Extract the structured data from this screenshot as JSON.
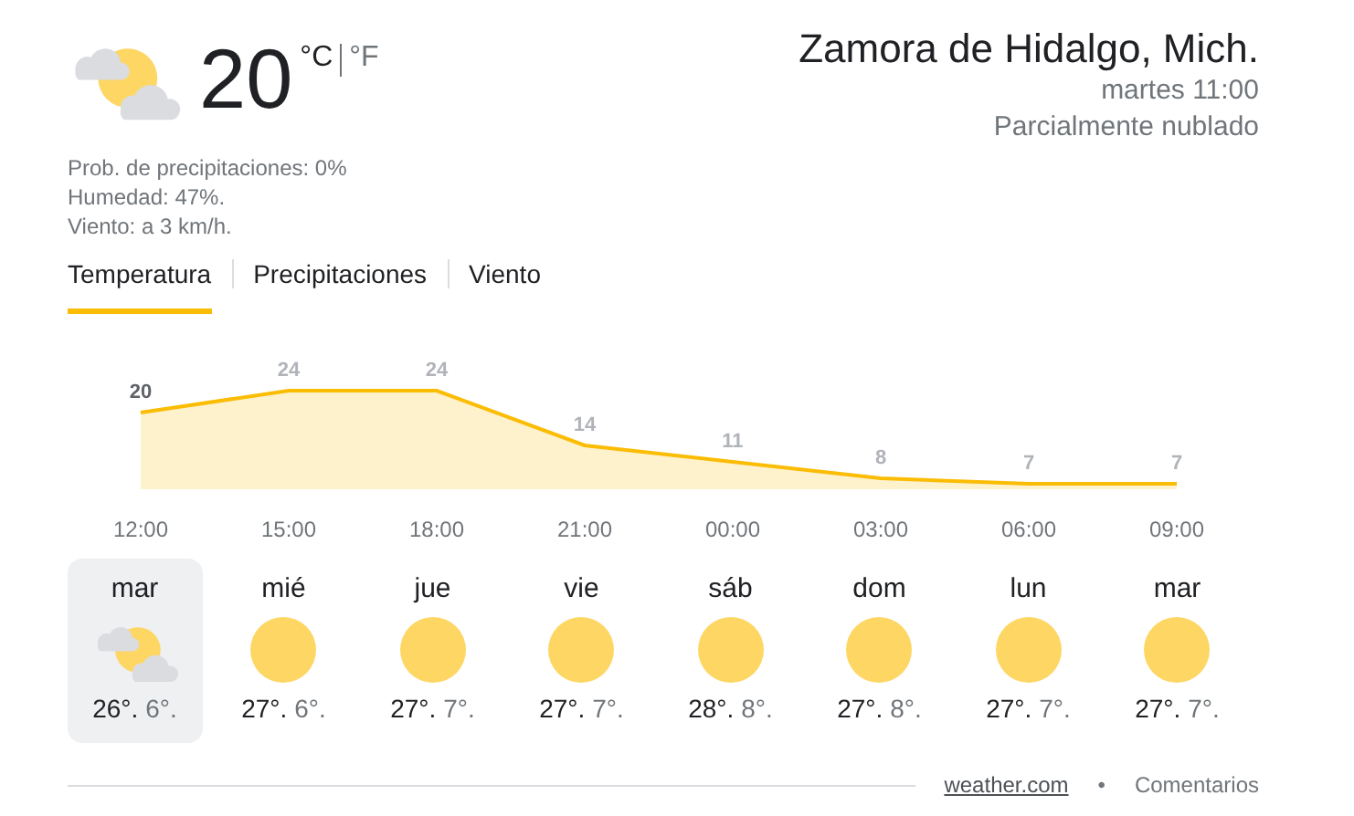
{
  "current": {
    "kind": "partly_cloudy",
    "temperature": "20",
    "units": [
      {
        "label": "°C",
        "selected": true
      },
      {
        "label": "°F",
        "selected": false
      }
    ],
    "details": [
      "Prob. de precipitaciones: 0%",
      "Humedad: 47%.",
      "Viento: a 3 km/h."
    ]
  },
  "location": {
    "name": "Zamora de Hidalgo, Mich.",
    "time": "martes 11:00",
    "condition": "Parcialmente nublado"
  },
  "tabs": [
    {
      "label": "Temperatura",
      "selected": true
    },
    {
      "label": "Precipitaciones",
      "selected": false
    },
    {
      "label": "Viento",
      "selected": false
    }
  ],
  "chart_data": {
    "type": "area",
    "categories": [
      "12:00",
      "15:00",
      "18:00",
      "21:00",
      "00:00",
      "03:00",
      "06:00",
      "09:00"
    ],
    "series": [
      {
        "color": "#fbbc04",
        "values": [
          20,
          24,
          24,
          14,
          11,
          8,
          7,
          7
        ]
      }
    ],
    "data_labels": true
  },
  "days": [
    {
      "day": "mar",
      "kind": "partly_cloudy",
      "high": "26°.",
      "low": "6°.",
      "selected": true
    },
    {
      "day": "mié",
      "kind": "sunny",
      "high": "27°.",
      "low": "6°.",
      "selected": false
    },
    {
      "day": "jue",
      "kind": "sunny",
      "high": "27°.",
      "low": "7°.",
      "selected": false
    },
    {
      "day": "vie",
      "kind": "sunny",
      "high": "27°.",
      "low": "7°.",
      "selected": false
    },
    {
      "day": "sáb",
      "kind": "sunny",
      "high": "28°.",
      "low": "8°.",
      "selected": false
    },
    {
      "day": "dom",
      "kind": "sunny",
      "high": "27°.",
      "low": "8°.",
      "selected": false
    },
    {
      "day": "lun",
      "kind": "sunny",
      "high": "27°.",
      "low": "7°.",
      "selected": false
    },
    {
      "day": "mar",
      "kind": "sunny",
      "high": "27°.",
      "low": "7°.",
      "selected": false
    }
  ],
  "footer": {
    "source": "weather.com",
    "separator": "•",
    "feedback": "Comentarios"
  }
}
